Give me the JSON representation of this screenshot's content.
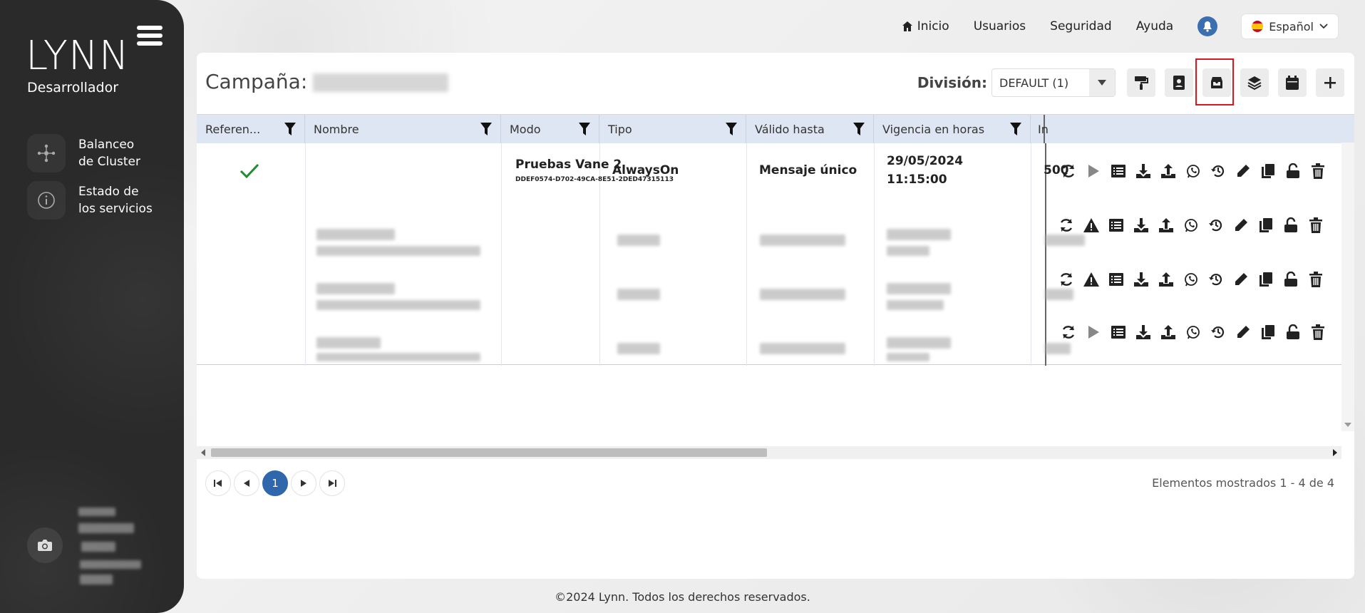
{
  "sidebar": {
    "logo": "LYNN",
    "role": "Desarrollador",
    "items": [
      {
        "label": "Balanceo\nde Cluster",
        "icon": "cluster-icon"
      },
      {
        "label": "Estado de\nlos servicios",
        "icon": "info-icon"
      }
    ],
    "camera_icon": "camera-icon"
  },
  "topnav": {
    "home": "Inicio",
    "users": "Usuarios",
    "security": "Seguridad",
    "help": "Ayuda",
    "language": "Español"
  },
  "panel": {
    "title_prefix": "Campaña:",
    "division_label": "División:",
    "division_value": "DEFAULT (1)",
    "toolbar_icons": [
      "paint-roller-icon",
      "contact-book-icon",
      "inbox-archive-icon",
      "layers-icon",
      "calendar-icon",
      "plus-icon"
    ]
  },
  "grid": {
    "columns": [
      "Referen...",
      "Nombre",
      "Modo",
      "Tipo",
      "Válido hasta",
      "Vigencia en horas",
      "In"
    ],
    "rows": [
      {
        "ref": "✓",
        "name": "Pruebas Vane 2",
        "id": "DDEF0574-D702-49CA-8E51-2DED47315113",
        "mode": "AlwaysOn",
        "type": "Mensaje único",
        "valid_date": "29/05/2024",
        "valid_time": "11:15:00",
        "hours": "500"
      }
    ]
  },
  "pager": {
    "current": "1",
    "summary": "Elementos mostrados 1 - 4 de 4"
  },
  "footer": "©2024 Lynn. Todos los derechos reservados."
}
